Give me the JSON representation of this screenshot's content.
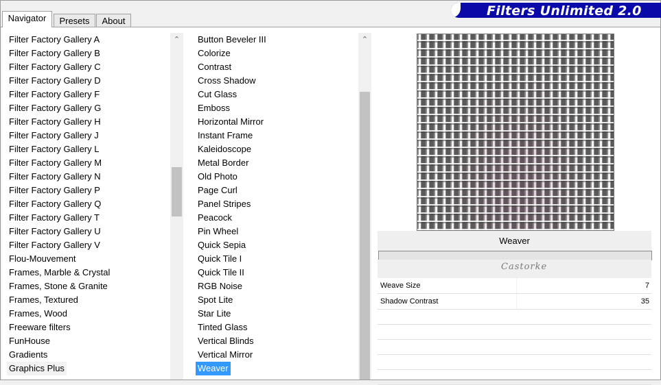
{
  "tabs": [
    {
      "label": "Navigator",
      "active": true
    },
    {
      "label": "Presets",
      "active": false
    },
    {
      "label": "About",
      "active": false
    }
  ],
  "banner": {
    "title": "Filters Unlimited 2.0",
    "color": "#0a0aa8"
  },
  "categories": [
    "Filter Factory Gallery A",
    "Filter Factory Gallery B",
    "Filter Factory Gallery C",
    "Filter Factory Gallery D",
    "Filter Factory Gallery F",
    "Filter Factory Gallery G",
    "Filter Factory Gallery H",
    "Filter Factory Gallery J",
    "Filter Factory Gallery L",
    "Filter Factory Gallery M",
    "Filter Factory Gallery N",
    "Filter Factory Gallery P",
    "Filter Factory Gallery Q",
    "Filter Factory Gallery T",
    "Filter Factory Gallery U",
    "Filter Factory Gallery V",
    "Flou-Mouvement",
    "Frames, Marble & Crystal",
    "Frames, Stone & Granite",
    "Frames, Textured",
    "Frames, Wood",
    "Freeware filters",
    "FunHouse",
    "Gradients",
    "Graphics Plus"
  ],
  "selected_category": "Graphics Plus",
  "filters": [
    "Button Beveler III",
    "Colorize",
    "Contrast",
    "Cross Shadow",
    "Cut Glass",
    "Emboss",
    "Horizontal Mirror",
    "Instant Frame",
    "Kaleidoscope",
    "Metal Border",
    "Old Photo",
    "Page Curl",
    "Panel Stripes",
    "Peacock",
    "Pin Wheel",
    "Quick Sepia",
    "Quick Tile I",
    "Quick Tile II",
    "RGB Noise",
    "Spot Lite",
    "Star Lite",
    "Tinted Glass",
    "Vertical Blinds",
    "Vertical Mirror",
    "Weaver"
  ],
  "selected_filter": "Weaver",
  "selection_color": "#3399ff",
  "preview": {
    "filter_name": "Weaver",
    "watermark": "Castorke"
  },
  "params": [
    {
      "label": "Weave Size",
      "value": "7"
    },
    {
      "label": "Shadow Contrast",
      "value": "35"
    }
  ],
  "empty_param_rows": 5,
  "scroll_icons": {
    "up": "chevron-up-icon"
  }
}
